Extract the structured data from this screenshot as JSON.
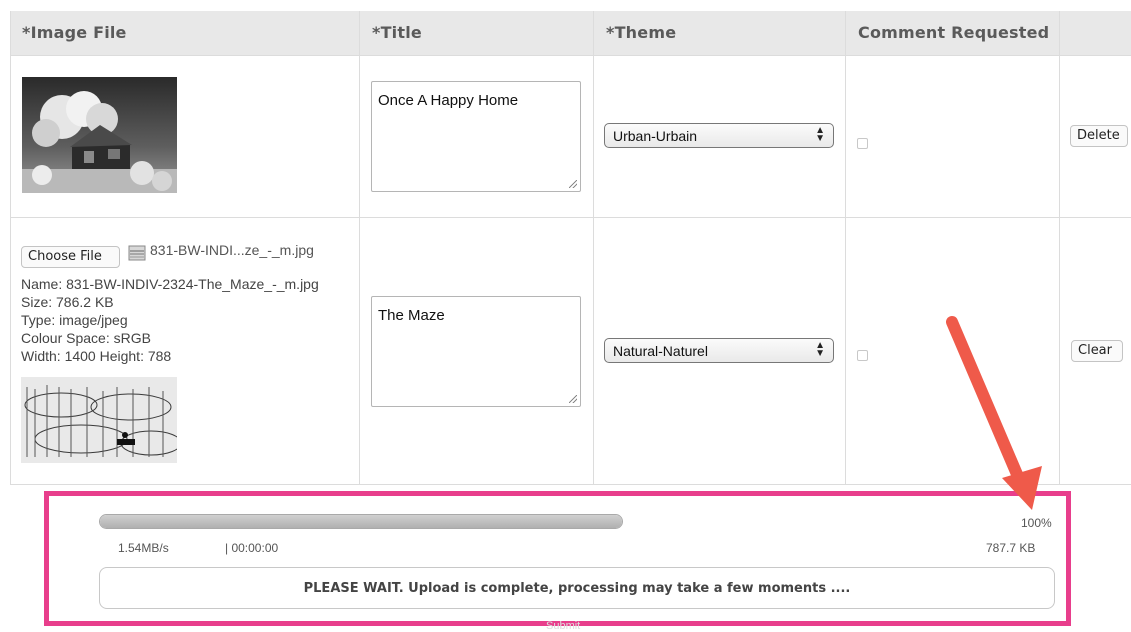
{
  "table": {
    "headers": [
      "*Image File",
      "*Title",
      "*Theme",
      "Comment Requested"
    ],
    "rows": [
      {
        "title": "Once A Happy Home",
        "theme": "Urban-Urbain",
        "comment_requested": false,
        "action": "Delete"
      },
      {
        "choose_file_label": "Choose File",
        "chosen_filename": "831-BW-INDI...ze_-_m.jpg",
        "meta": {
          "name": "Name: 831-BW-INDIV-2324-The_Maze_-_m.jpg",
          "size": "Size: 786.2 KB",
          "type": "Type: image/jpeg",
          "colour_space": "Colour Space: sRGB",
          "dimensions": "Width: 1400 Height: 788"
        },
        "title": "The Maze",
        "theme": "Natural-Naturel",
        "comment_requested": false,
        "action": "Clear"
      }
    ]
  },
  "upload": {
    "progress_fraction": 1.0,
    "percent_label": "100%",
    "speed": "1.54MB/s",
    "elapsed": "| 00:00:00",
    "total_size": "787.7 KB",
    "message": "PLEASE WAIT. Upload is complete, processing may take a few moments ....",
    "faint_button": "Submit"
  },
  "colors": {
    "highlight_border": "#e83e8c",
    "annotation_arrow": "#ef5a4a",
    "header_bg": "#e8e8e8"
  },
  "icons": [
    "image-file-icon",
    "select-arrows-icon",
    "annotation-arrow"
  ]
}
